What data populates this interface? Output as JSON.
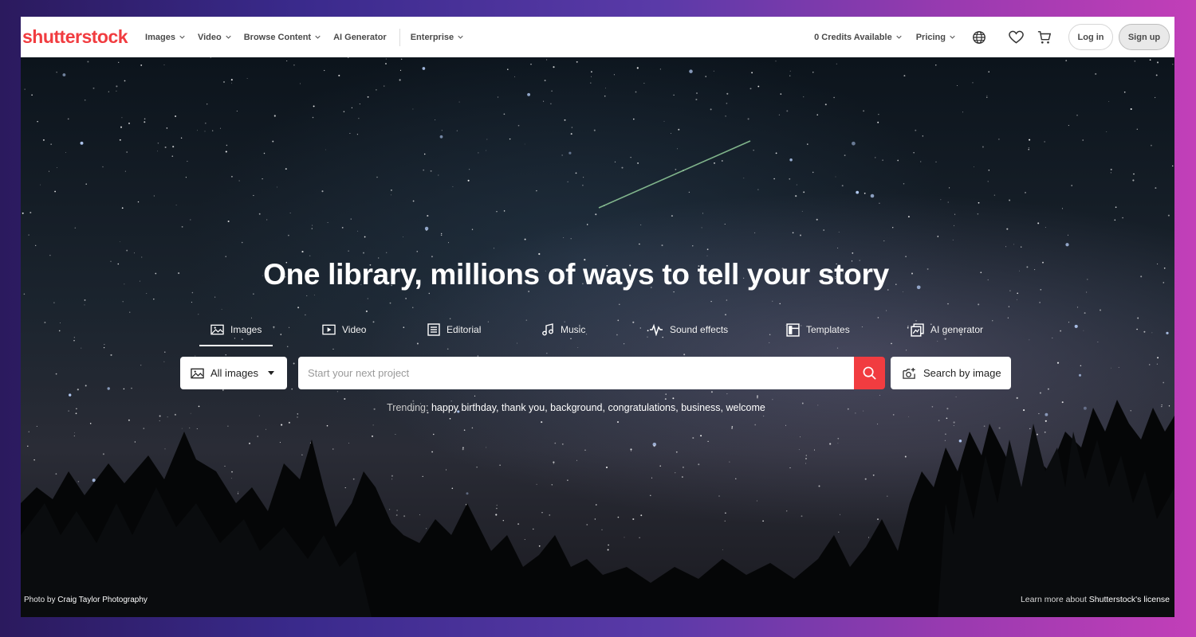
{
  "header": {
    "logo": "shutterstock",
    "nav": [
      {
        "label": "Images",
        "dropdown": true
      },
      {
        "label": "Video",
        "dropdown": true
      },
      {
        "label": "Browse Content",
        "dropdown": true
      },
      {
        "label": "AI Generator",
        "dropdown": false
      },
      {
        "label": "Enterprise",
        "dropdown": true
      }
    ],
    "credits_label": "0 Credits Available",
    "pricing_label": "Pricing",
    "login_label": "Log in",
    "signup_label": "Sign up",
    "icons": [
      "globe-icon",
      "heart-icon",
      "cart-icon"
    ]
  },
  "hero": {
    "headline": "One library, millions of ways to tell your story",
    "tabs": [
      {
        "label": "Images",
        "icon": "image-icon",
        "active": true
      },
      {
        "label": "Video",
        "icon": "video-icon",
        "active": false
      },
      {
        "label": "Editorial",
        "icon": "editorial-icon",
        "active": false
      },
      {
        "label": "Music",
        "icon": "music-icon",
        "active": false
      },
      {
        "label": "Sound effects",
        "icon": "sound-effects-icon",
        "active": false
      },
      {
        "label": "Templates",
        "icon": "templates-icon",
        "active": false
      },
      {
        "label": "AI generator",
        "icon": "ai-generator-icon",
        "active": false
      }
    ],
    "search": {
      "type_label": "All images",
      "placeholder": "Start your next project",
      "value": "",
      "search_by_image_label": "Search by image"
    },
    "trending": {
      "label": "Trending:",
      "items": [
        "happy birthday,",
        "thank you,",
        "background,",
        "congratulations,",
        "business,",
        "welcome"
      ]
    },
    "photo_credit": {
      "prefix": "Photo",
      "by": "by",
      "author": "Craig Taylor Photography"
    },
    "license": {
      "prefix": "Learn more about",
      "link": "Shutterstock's license"
    }
  },
  "colors": {
    "brand": "#f13c40",
    "search_button": "#f13c40"
  }
}
